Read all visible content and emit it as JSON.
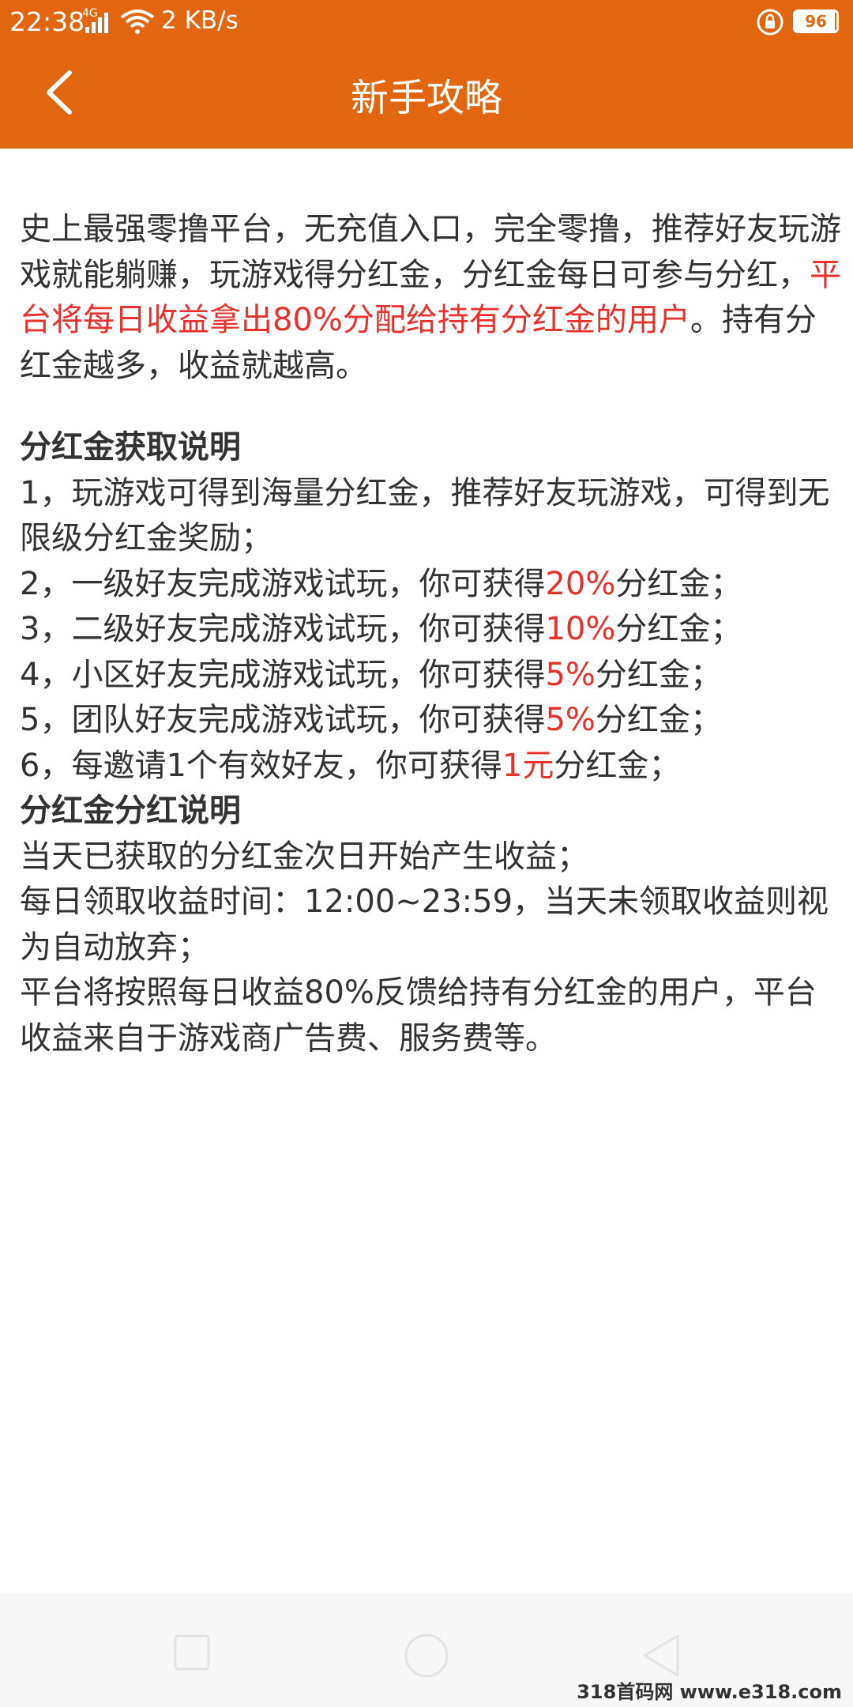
{
  "status_bar": {
    "time": "22:38",
    "network_type": "4G",
    "speed": "2 KB/s",
    "battery_level": "96",
    "battery_fraction": 0.96
  },
  "header": {
    "title": "新手攻略",
    "back_icon": "chevron-left-icon",
    "color": "#e2650f"
  },
  "intro": {
    "part1": "史上最强零撸平台，无充值入口，完全零撸，推荐好友玩游戏就能躺赚，玩游戏得分红金，分红金每日可参与分红，",
    "highlight": "平台将每日收益拿出80%分配给持有分红金的用户",
    "part2": "。持有分红金越多，收益就越高。"
  },
  "acquire_section": {
    "title": "分红金获取说明",
    "items": [
      {
        "pre": "1，玩游戏可得到海量分红金，推荐好友玩游戏，可得到无限级分红金奖励；",
        "hl": "",
        "post": ""
      },
      {
        "pre": "2，一级好友完成游戏试玩，你可获得",
        "hl": "20%",
        "post": "分红金；"
      },
      {
        "pre": "3，二级好友完成游戏试玩，你可获得",
        "hl": "10%",
        "post": "分红金；"
      },
      {
        "pre": "4，小区好友完成游戏试玩，你可获得",
        "hl": "5%",
        "post": "分红金；"
      },
      {
        "pre": "5，团队好友完成游戏试玩，你可获得",
        "hl": "5%",
        "post": "分红金；"
      },
      {
        "pre": "6，每邀请1个有效好友，你可获得",
        "hl": "1元",
        "post": "分红金；"
      }
    ]
  },
  "dividend_section": {
    "title": "分红金分红说明",
    "items": [
      "当天已获取的分红金次日开始产生收益；",
      "每日领取收益时间：12:00~23:59，当天未领取收益则视为自动放弃；",
      "平台将按照每日收益80%反馈给持有分红金的用户，平台收益来自于游戏商广告费、服务费等。"
    ]
  },
  "nav_bar": {
    "recent_icon": "square-icon",
    "home_icon": "circle-icon",
    "back_icon": "triangle-back-icon"
  },
  "watermark": "318首码网 www.e318.com",
  "colors": {
    "highlight": "#e8312a",
    "text": "#333333"
  }
}
